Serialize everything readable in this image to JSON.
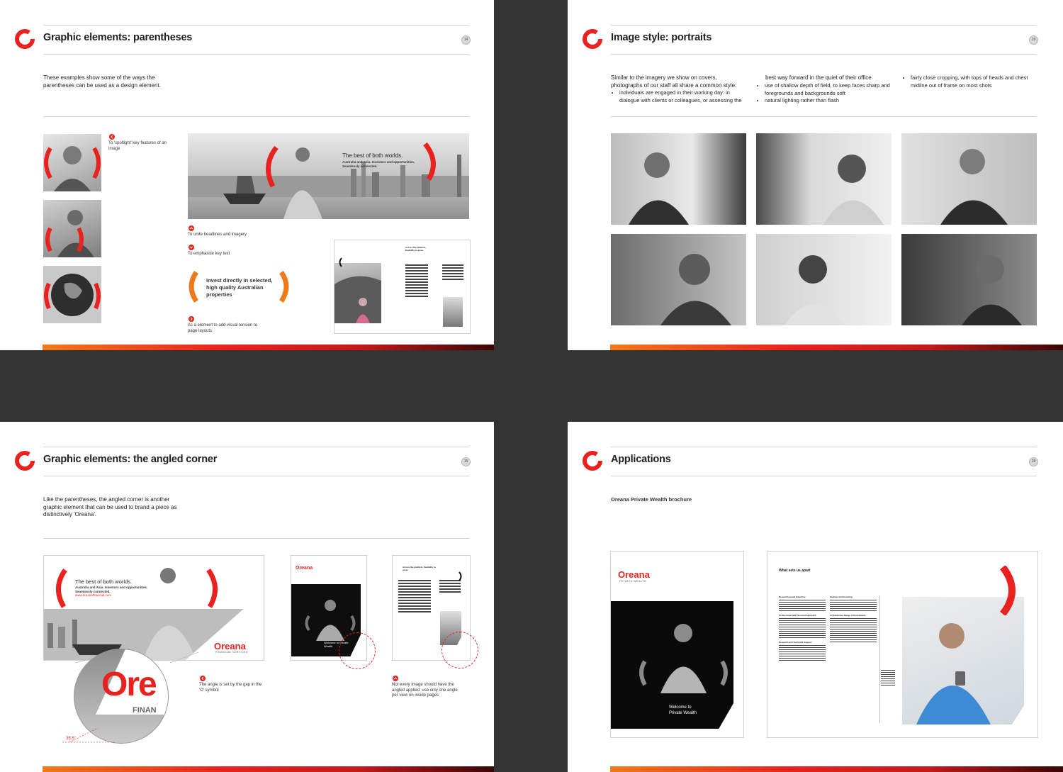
{
  "pages": [
    {
      "title": "Graphic elements: parentheses",
      "page_number": "14",
      "intro": "These examples show some of the ways the parentheses can be used as a design element.",
      "notes": {
        "spotlight": "To 'spotlight' key features of an image",
        "unite": "To unite headlines and imagery",
        "emphasise": "To emphasise key text",
        "tension": "As a element to add visual tension to page layouts"
      },
      "banner_headline": "The best of both worlds.",
      "banner_sub": "Australia and Asia. Investors and opportunities. Seamlessly connected.",
      "emphasis_text": "Invest directly in selected, high quality Australian properties",
      "spread_headline": "Across the platform, flexibility to grow."
    },
    {
      "title": "Image style: portraits",
      "page_number": "19",
      "col1_intro": "Similar to the imagery we show on covers, photographs of our staff all share a common style:",
      "col1_bullet": "individuals are engaged in their working day: in dialogue with clients or colleagues, or assessing the",
      "col2_lead": "best way forward in the quiet of their office",
      "col2_bullets": [
        "use of shallow depth of field, to keep faces sharp and foregrounds and backgrounds soft",
        "natural lighting rather than flash"
      ],
      "col3_bullets": [
        "fairly close cropping, with tops of heads and chest midline out of frame on most shots"
      ]
    },
    {
      "title": "Graphic elements: the angled corner",
      "page_number": "15",
      "intro": "Like the parentheses, the angled corner is another graphic element that can be used to brand a piece as distinctively 'Oreana'.",
      "banner_headline": "The best of both worlds.",
      "banner_sub": "Australia and Asia. Investors and opportunities. Seamlessly connected.",
      "banner_url": "www.oreanafinancial.com",
      "brand_name": "Oreana",
      "brand_sub": "FINANCIAL SERVICES",
      "zoom_brand": "Ore",
      "zoom_sub": "FINAN",
      "angle_label": "35.5°",
      "note_angle": "The angle is set by the gap in the 'O' symbol",
      "note_pages": "Not every image should have the angled applied: use only one angle per view on inside pages",
      "thumb_title": "Welcome to Private Wealth"
    },
    {
      "title": "Applications",
      "page_number": "28",
      "subtitle": "Oreana Private Wealth brochure",
      "brand_name": "Oreana",
      "brand_sub": "PRIVATE WEALTH",
      "cover_title_1": "Welcome to",
      "cover_title_2": "Private Wealth",
      "spread_heading": "What sets us apart",
      "spread_subheads": [
        "Research-based Expertise",
        "Professional and Personal Approach",
        "Research and Technical Support",
        "Savings and Investing",
        "An Extensive Range of Investments"
      ]
    }
  ],
  "colors": {
    "brand_red": "#e8231f",
    "brand_orange": "#f07a1a"
  }
}
